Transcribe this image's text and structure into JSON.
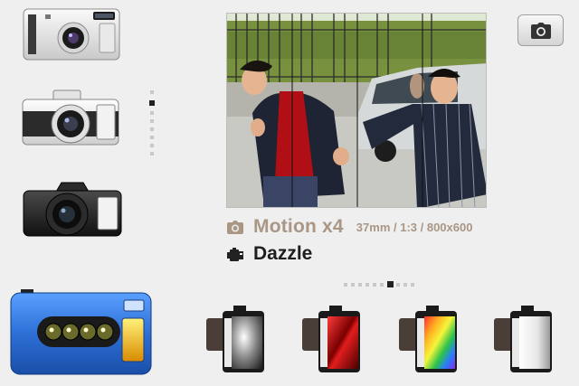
{
  "cameras": [
    {
      "icon": "silver-compact-camera-icon",
      "selected": false
    },
    {
      "icon": "retro-rangefinder-camera-icon",
      "selected": false
    },
    {
      "icon": "black-slr-camera-icon",
      "selected": false
    },
    {
      "icon": "blue-four-lens-camera-icon",
      "selected": true
    }
  ],
  "camera_pager": {
    "count": 8,
    "active_index": 0
  },
  "preview": {
    "icon": "motion-x4-sample-photo"
  },
  "shutter_button": {
    "icon": "camera-icon"
  },
  "camera_info": {
    "name": "Motion x4",
    "specs": "37mm / 1:3 / 800x600",
    "icon": "camera-small-icon"
  },
  "film_info": {
    "name": "Dazzle",
    "icon": "film-canister-small-icon"
  },
  "film_pager": {
    "count": 11,
    "active_index": 6
  },
  "films": [
    {
      "icon": "film-monochrome-icon",
      "selected": false
    },
    {
      "icon": "film-red-icon",
      "selected": false
    },
    {
      "icon": "film-rainbow-icon",
      "selected": false
    },
    {
      "icon": "film-silver-icon",
      "selected": false
    }
  ],
  "colors": {
    "background": "#efefef",
    "info_text": "#a99684",
    "film_text": "#1e1e1e",
    "accent_blue": "#2d6fd6"
  }
}
